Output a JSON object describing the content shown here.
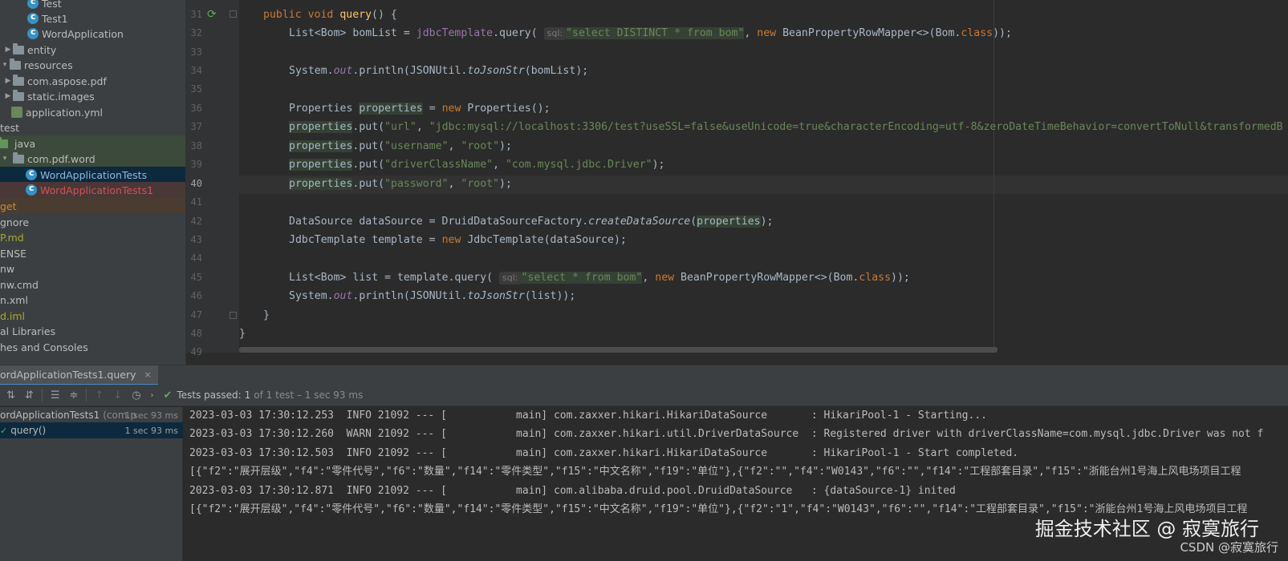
{
  "project_tree": [
    {
      "label": "Test",
      "icon": "class-icon",
      "indent": 34
    },
    {
      "label": "Test1",
      "icon": "class-icon",
      "indent": 34
    },
    {
      "label": "WordApplication",
      "icon": "class-icon",
      "indent": 34
    },
    {
      "label": "entity",
      "icon": "folder-icon",
      "indent": 16,
      "arrow": "▶"
    },
    {
      "label": "resources",
      "icon": "folder-icon",
      "indent": 0,
      "arrow": "▾"
    },
    {
      "label": "com.aspose.pdf",
      "icon": "folder-icon",
      "indent": 16,
      "arrow": "▶"
    },
    {
      "label": "static.images",
      "icon": "folder-icon",
      "indent": 16,
      "arrow": "▶"
    },
    {
      "label": "application.yml",
      "icon": "yml-icon",
      "indent": 16
    },
    {
      "label": "test",
      "icon": "",
      "indent": 0
    },
    {
      "label": "java",
      "icon": "folder-icon",
      "indent": 0,
      "arrow": "▾"
    },
    {
      "label": "com.pdf.word",
      "icon": "folder-icon",
      "indent": 0,
      "arrow": "▾"
    },
    {
      "label": "WordApplicationTests",
      "icon": "class-icon",
      "indent": 34
    },
    {
      "label": "WordApplicationTests1",
      "icon": "class-icon",
      "indent": 34
    },
    {
      "label": "get",
      "icon": "",
      "indent": 0
    },
    {
      "label": "gnore",
      "icon": "",
      "indent": 0
    },
    {
      "label": "P.md",
      "icon": "",
      "indent": 0
    },
    {
      "label": "ENSE",
      "icon": "",
      "indent": 0
    },
    {
      "label": "nw",
      "icon": "",
      "indent": 0
    },
    {
      "label": "nw.cmd",
      "icon": "",
      "indent": 0
    },
    {
      "label": "n.xml",
      "icon": "",
      "indent": 0
    },
    {
      "label": "d.iml",
      "icon": "",
      "indent": 0
    },
    {
      "label": "al Libraries",
      "icon": "",
      "indent": 0
    },
    {
      "label": "hes and Consoles",
      "icon": "",
      "indent": 0
    }
  ],
  "editor": {
    "line_numbers": [
      "31",
      "32",
      "33",
      "34",
      "35",
      "36",
      "37",
      "38",
      "39",
      "40",
      "41",
      "42",
      "43",
      "44",
      "45",
      "46",
      "47",
      "48",
      "49"
    ],
    "current_line": "40",
    "code": {
      "l31_kw1": "public",
      "l31_kw2": "void",
      "l31_fn": "query",
      "l31_rest": "() {",
      "l32_a": "List<Bom> bomList = ",
      "l32_b": "jdbcTemplate",
      "l32_c": ".query(",
      "l32_hint": "sql:",
      "l32_str": "\"select DISTINCT * from bom\"",
      "l32_d": ", ",
      "l32_kw": "new",
      "l32_e": " BeanPropertyRowMapper<>(Bom.",
      "l32_kw2": "class",
      "l32_f": "));",
      "l34_a": "System.",
      "l34_b": "out",
      "l34_c": ".println(JSONUtil.",
      "l34_d": "toJsonStr",
      "l34_e": "(bomList);",
      "l36_a": "Properties ",
      "l36_b": "properties",
      "l36_c": " = ",
      "l36_kw": "new",
      "l36_d": " Properties();",
      "l37_a": "properties",
      "l37_b": ".put(",
      "l37_s1": "\"url\"",
      "l37_c": ", ",
      "l37_s2": "\"jdbc:mysql://localhost:3306/test?useSSL=false&useUnicode=true&characterEncoding=utf-8&zeroDateTimeBehavior=convertToNull&transformedB",
      "l38_a": "properties",
      "l38_b": ".put(",
      "l38_s1": "\"username\"",
      "l38_c": ", ",
      "l38_s2": "\"root\"",
      "l38_d": ");",
      "l39_a": "properties",
      "l39_b": ".put(",
      "l39_s1": "\"driverClassName\"",
      "l39_c": ", ",
      "l39_s2": "\"com.mysql.jdbc.Driver\"",
      "l39_d": ");",
      "l40_a": "properties",
      "l40_b": ".put(",
      "l40_s1": "\"password\"",
      "l40_c": ", ",
      "l40_s2": "\"root\"",
      "l40_d": ");",
      "l42_a": "DataSource dataSource = DruidDataSourceFactory.",
      "l42_b": "createDataSource",
      "l42_c": "(",
      "l42_d": "properties",
      "l42_e": ");",
      "l43_a": "JdbcTemplate template = ",
      "l43_kw": "new",
      "l43_b": " JdbcTemplate(dataSource);",
      "l45_a": "List<Bom> list = template.query(",
      "l45_hint": "sql:",
      "l45_str": "\"select * from bom\"",
      "l45_b": ", ",
      "l45_kw": "new",
      "l45_c": " BeanPropertyRowMapper<>(Bom.",
      "l45_kw2": "class",
      "l45_d": "));",
      "l46_a": "System.",
      "l46_b": "out",
      "l46_c": ".println(JSONUtil.",
      "l46_d": "toJsonStr",
      "l46_e": "(list));",
      "l47": "}",
      "l48": "}"
    }
  },
  "run_panel": {
    "tab_label": "ordApplicationTests1.query",
    "status": "Tests passed:",
    "status_count": "1",
    "status_detail": "of 1 test – 1 sec 93 ms",
    "tree": [
      {
        "label": "ordApplicationTests1",
        "muted": "(com.p",
        "time": "1 sec 93 ms"
      },
      {
        "label": "query()",
        "time": "1 sec 93 ms"
      }
    ],
    "console": [
      "2023-03-03 17:30:12.253  INFO 21092 --- [           main] com.zaxxer.hikari.HikariDataSource       : HikariPool-1 - Starting...",
      "2023-03-03 17:30:12.260  WARN 21092 --- [           main] com.zaxxer.hikari.util.DriverDataSource  : Registered driver with driverClassName=com.mysql.jdbc.Driver was not f",
      "2023-03-03 17:30:12.503  INFO 21092 --- [           main] com.zaxxer.hikari.HikariDataSource       : HikariPool-1 - Start completed.",
      "[{\"f2\":\"展开层级\",\"f4\":\"零件代号\",\"f6\":\"数量\",\"f14\":\"零件类型\",\"f15\":\"中文名称\",\"f19\":\"单位\"},{\"f2\":\"\",\"f4\":\"W0143\",\"f6\":\"\",\"f14\":\"工程部套目录\",\"f15\":\"浙能台州1号海上风电场项目工程",
      "2023-03-03 17:30:12.871  INFO 21092 --- [           main] com.alibaba.druid.pool.DruidDataSource   : {dataSource-1} inited",
      "[{\"f2\":\"展开层级\",\"f4\":\"零件代号\",\"f6\":\"数量\",\"f14\":\"零件类型\",\"f15\":\"中文名称\",\"f19\":\"单位\"},{\"f2\":\"1\",\"f4\":\"W0143\",\"f6\":\"\",\"f14\":\"工程部套目录\",\"f15\":\"浙能台州1号海上风电场项目工程"
    ]
  },
  "watermark": {
    "main": "掘金技术社区 @ 寂寞旅行",
    "sub": "CSDN @寂寞旅行"
  }
}
